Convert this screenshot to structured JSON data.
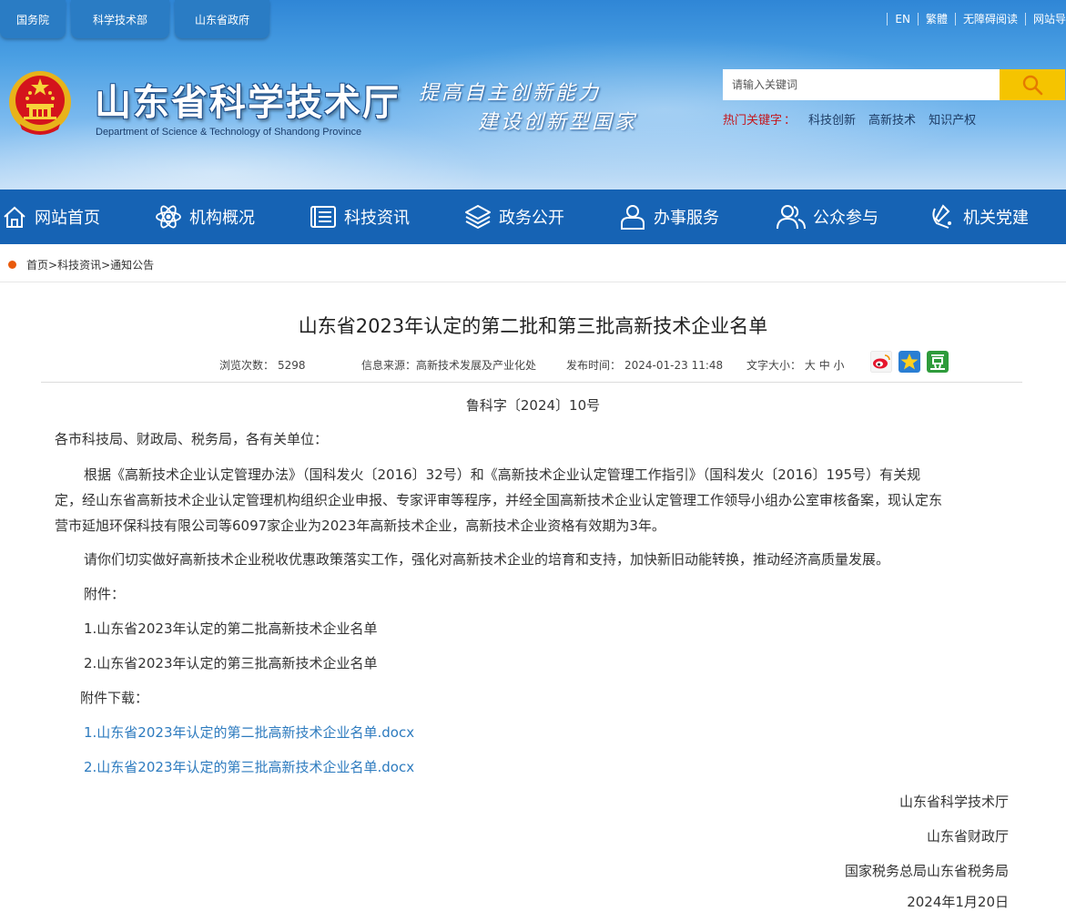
{
  "external_links": [
    "国务院",
    "科学技术部",
    "山东省政府"
  ],
  "top_links": [
    "EN",
    "繁體",
    "无障碍阅读",
    "网站导航"
  ],
  "header": {
    "title": "山东省科学技术厅",
    "subtitle": "Department of Science & Technology of Shandong Province",
    "slogan_line1": "提高自主创新能力",
    "slogan_line2": "建设创新型国家"
  },
  "search": {
    "placeholder": "请输入关键词",
    "hot_label": "热门关键字",
    "hot_colon": "：",
    "hot_keywords": [
      "科技创新",
      "高新技术",
      "知识产权"
    ]
  },
  "nav": [
    {
      "label": "网站首页",
      "icon": "home-icon"
    },
    {
      "label": "机构概况",
      "icon": "atom-icon"
    },
    {
      "label": "科技资讯",
      "icon": "news-icon"
    },
    {
      "label": "政务公开",
      "icon": "layers-icon"
    },
    {
      "label": "办事服务",
      "icon": "user-service-icon"
    },
    {
      "label": "公众参与",
      "icon": "people-icon"
    },
    {
      "label": "机关党建",
      "icon": "party-icon"
    }
  ],
  "breadcrumb": [
    "首页",
    "科技资讯",
    "通知公告"
  ],
  "breadcrumb_sep": ">",
  "article": {
    "title": "山东省2023年认定的第二批和第三批高新技术企业名单",
    "views_label": "浏览次数：",
    "views": "5298",
    "source_label": "信息来源：",
    "source": "高新技术发展及产业化处",
    "date_label": "发布时间：",
    "date": "2024-01-23 11:48",
    "fontsize_label": "文字大小：",
    "fontsize_options": [
      "大",
      "中",
      "小"
    ],
    "doc_number": "鲁科字〔2024〕10号",
    "salutation": "各市科技局、财政局、税务局，各有关单位：",
    "para1_line1": "根据《高新技术企业认定管理办法》（国科发火〔2016〕32号）和《高新技术企业认定管理工作指引》（国科发火〔2016〕195号）有关规",
    "para1_line2": "定，经山东省高新技术企业认定管理机构组织企业申报、专家评审等程序，并经全国高新技术企业认定管理工作领导小组办公室审核备案，现认定东",
    "para1_line3": "营市延旭环保科技有限公司等6097家企业为2023年高新技术企业，高新技术企业资格有效期为3年。",
    "para2": "请你们切实做好高新技术企业税收优惠政策落实工作，强化对高新技术企业的培育和支持，加快新旧动能转换，推动经济高质量发展。",
    "attach_label": "附件：",
    "attach1": "1.山东省2023年认定的第二批高新技术企业名单",
    "attach2": "2.山东省2023年认定的第三批高新技术企业名单",
    "download_label": "附件下载：",
    "download1": "1.山东省2023年认定的第二批高新技术企业名单.docx",
    "download2": "2.山东省2023年认定的第三批高新技术企业名单.docx",
    "signer1": "山东省科学技术厅",
    "signer2": "山东省财政厅",
    "signer3": "国家税务总局山东省税务局",
    "sign_date": "2024年1月20日"
  },
  "colors": {
    "nav_bg": "#1663b4",
    "link": "#2d7bbf",
    "hot_label": "#c4161c",
    "search_button": "#f5c400"
  }
}
